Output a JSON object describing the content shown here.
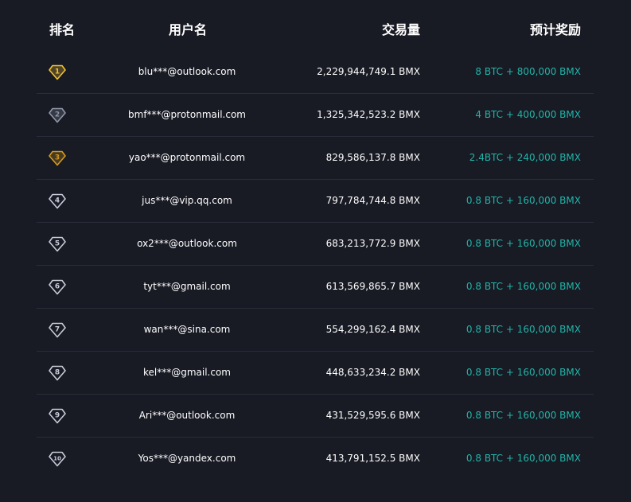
{
  "header": {
    "rank": "排名",
    "user": "用户名",
    "volume": "交易量",
    "reward": "预计奖励"
  },
  "colors": {
    "gold": "#f2c32f",
    "silver": "#8f98a8",
    "bronze": "#d49b1d",
    "plain": "#c8ccd6",
    "reward": "#21b5a8",
    "background": "#181a24"
  },
  "rows": [
    {
      "rank": "1",
      "badge_icon": "gold-gem-icon",
      "user": "blu***@outlook.com",
      "volume": "2,229,944,749.1 BMX",
      "reward": "8 BTC + 800,000 BMX"
    },
    {
      "rank": "2",
      "badge_icon": "silver-gem-icon",
      "user": "bmf***@protonmail.com",
      "volume": "1,325,342,523.2 BMX",
      "reward": "4 BTC + 400,000 BMX"
    },
    {
      "rank": "3",
      "badge_icon": "bronze-gem-icon",
      "user": "yao***@protonmail.com",
      "volume": "829,586,137.8 BMX",
      "reward": "2.4BTC + 240,000 BMX"
    },
    {
      "rank": "4",
      "badge_icon": "gem-icon",
      "user": "jus***@vip.qq.com",
      "volume": "797,784,744.8 BMX",
      "reward": "0.8 BTC + 160,000 BMX"
    },
    {
      "rank": "5",
      "badge_icon": "gem-icon",
      "user": "ox2***@outlook.com",
      "volume": "683,213,772.9 BMX",
      "reward": "0.8 BTC + 160,000 BMX"
    },
    {
      "rank": "6",
      "badge_icon": "gem-icon",
      "user": "tyt***@gmail.com",
      "volume": "613,569,865.7 BMX",
      "reward": "0.8 BTC + 160,000 BMX"
    },
    {
      "rank": "7",
      "badge_icon": "gem-icon",
      "user": "wan***@sina.com",
      "volume": "554,299,162.4 BMX",
      "reward": "0.8 BTC + 160,000 BMX"
    },
    {
      "rank": "8",
      "badge_icon": "gem-icon",
      "user": "kel***@gmail.com",
      "volume": "448,633,234.2 BMX",
      "reward": "0.8 BTC + 160,000 BMX"
    },
    {
      "rank": "9",
      "badge_icon": "gem-icon",
      "user": "Ari***@outlook.com",
      "volume": "431,529,595.6 BMX",
      "reward": "0.8 BTC + 160,000 BMX"
    },
    {
      "rank": "10",
      "badge_icon": "gem-icon",
      "user": "Yos***@yandex.com",
      "volume": "413,791,152.5 BMX",
      "reward": "0.8 BTC + 160,000 BMX"
    }
  ]
}
